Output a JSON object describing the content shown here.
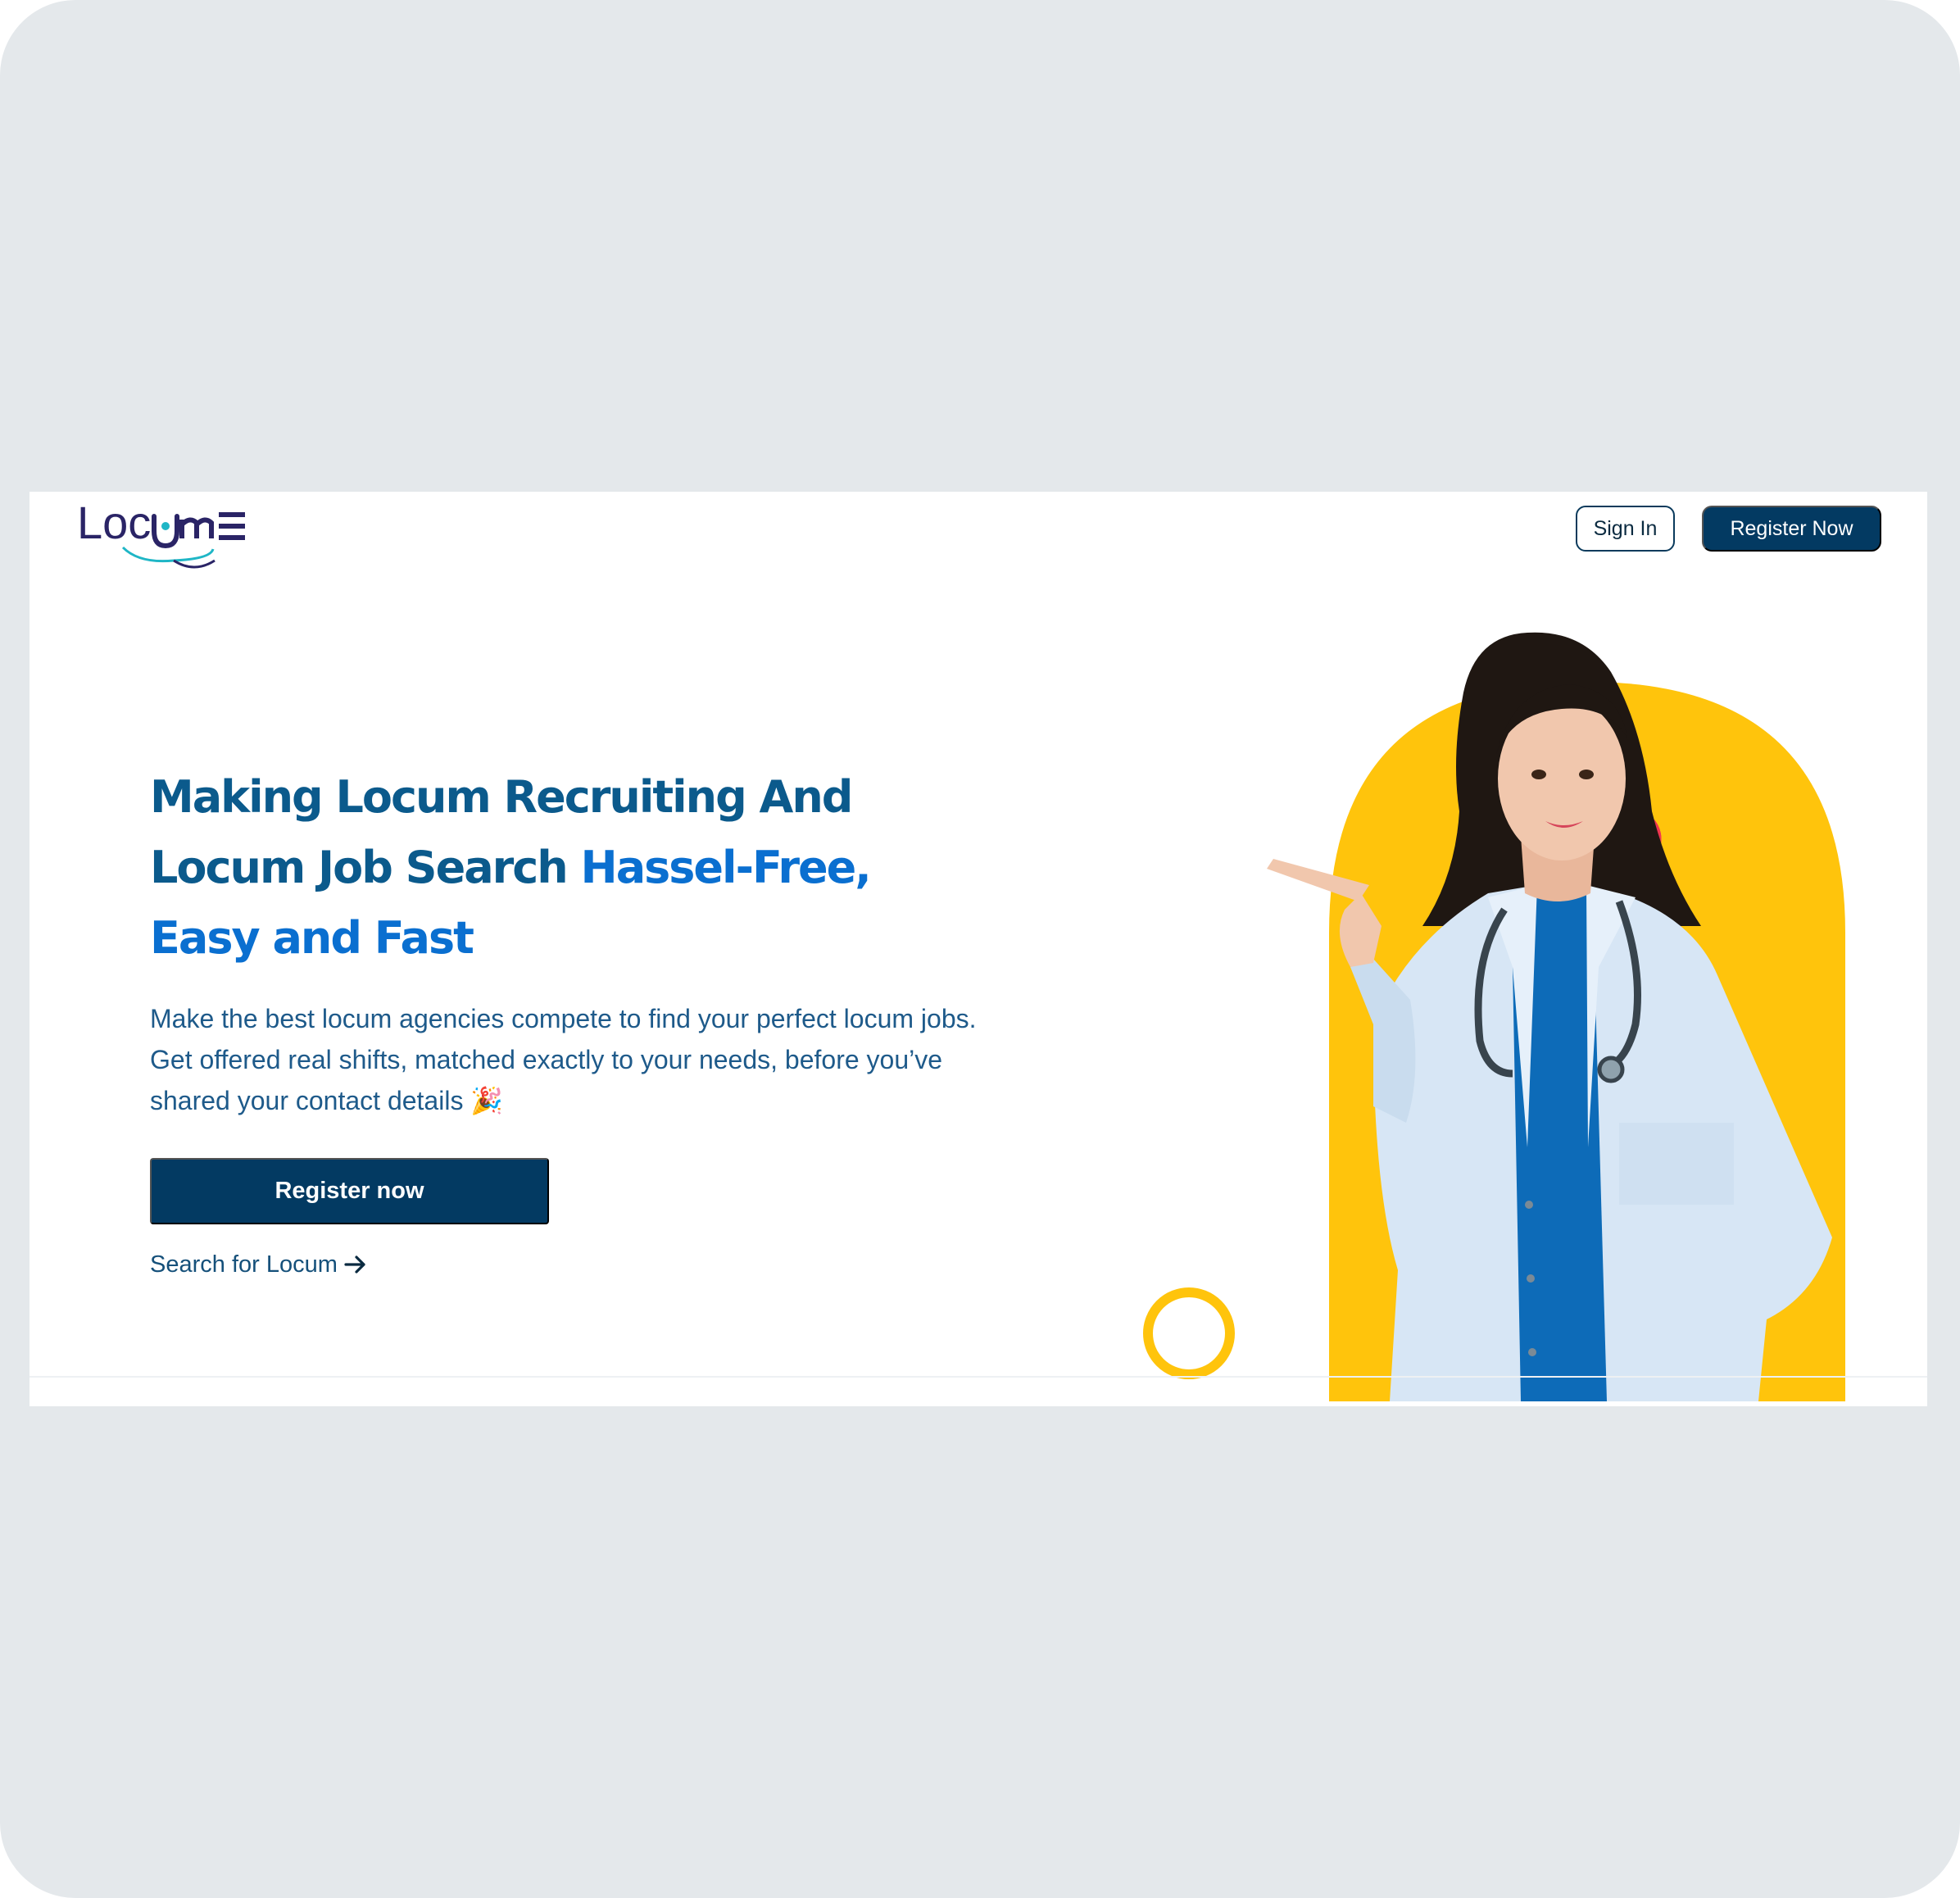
{
  "brand": {
    "logo_text": "Locum",
    "logo_icon": "stethoscope-icon",
    "colors": {
      "navy": "#033a62",
      "blue": "#0a6fd0",
      "yellow": "#ffc40c",
      "red": "#f0364f"
    }
  },
  "header": {
    "sign_in_label": "Sign In",
    "register_label": "Register Now"
  },
  "hero": {
    "headline_part1": "Making Locum Recruiting And Locum Job Search ",
    "headline_accent": "Hassel-Free, Easy and Fast",
    "subtext": "Make the best locum agencies compete to find your perfect locum jobs. Get offered real shifts, matched exactly to your needs, before you’ve shared your contact details",
    "subtext_emoji": "🎉",
    "cta_label": "Register now",
    "search_link_label": "Search for Locum",
    "search_link_icon": "arrow-right-icon",
    "image_alt": "doctor-pointing"
  }
}
